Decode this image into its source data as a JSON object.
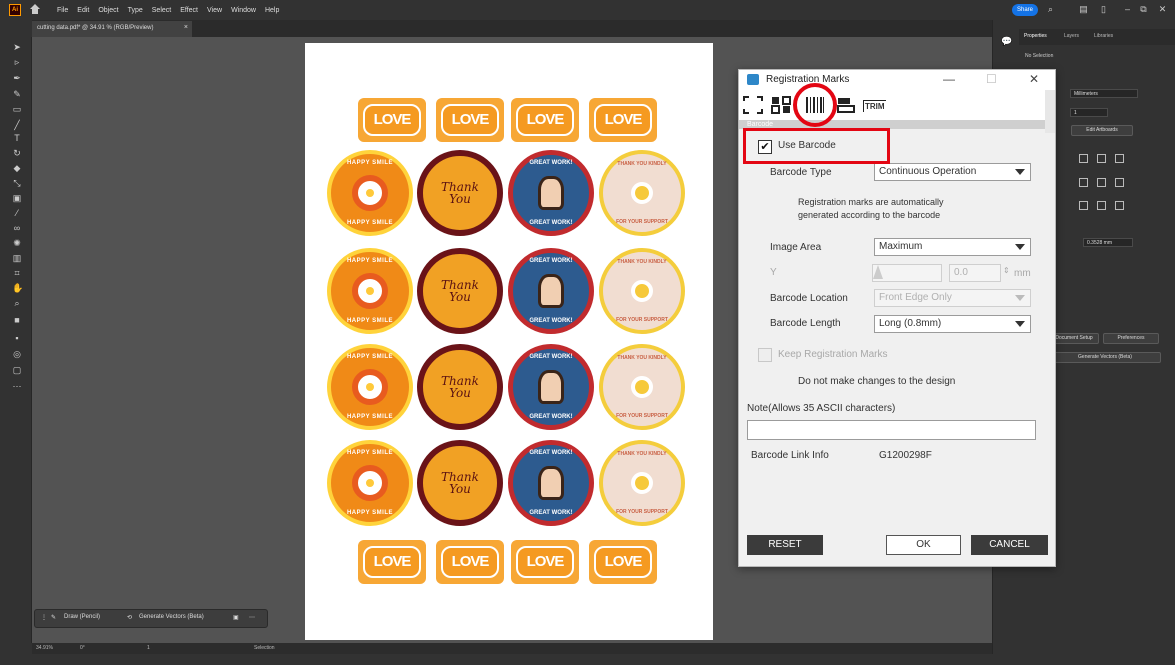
{
  "app": {
    "logo": "Ai",
    "menus": [
      "File",
      "Edit",
      "Object",
      "Type",
      "Select",
      "Effect",
      "View",
      "Window",
      "Help"
    ],
    "share_label": "Share"
  },
  "document": {
    "tab_title": "cutting data.pdf* @ 34.91 % (RGB/Preview)",
    "tab_close": "×"
  },
  "artboard": {
    "love_label": "LOVE",
    "happy_top": "HAPPY SMILE",
    "happy_bottom": "HAPPY SMILE",
    "thank_line1": "Thank",
    "thank_line2": "You",
    "great_top": "GREAT WORK!",
    "great_bottom": "GREAT WORK!",
    "kind_top": "THANK YOU KINDLY",
    "kind_bottom": "FOR YOUR SUPPORT"
  },
  "floating_bar": {
    "draw_label": "Draw (Pencil)",
    "generate_label": "Generate Vectors (Beta)",
    "more": "⋯"
  },
  "status_bar": {
    "zoom": "34.91%",
    "rotation": "0°",
    "artboard": "1",
    "mode": "Selection"
  },
  "right_panel": {
    "tabs": [
      "Properties",
      "Layers",
      "Libraries"
    ],
    "no_selection": "No Selection",
    "units_value": "Millimeters",
    "artboard_value": "1",
    "edit_artboards": "Edit Artboards",
    "increment_value": "0.3528 mm",
    "doc_setup": "Document Setup",
    "preferences": "Preferences",
    "generate_vectors": "Generate Vectors (Beta)"
  },
  "dialog": {
    "title": "Registration Marks",
    "section_header": "Barcode",
    "trim_label": "TRIM",
    "use_barcode_label": "Use Barcode",
    "use_barcode_checked": "✔",
    "barcode_type_label": "Barcode Type",
    "barcode_type_value": "Continuous Operation",
    "info_line1": "Registration marks are automatically",
    "info_line2": "generated according to the barcode",
    "image_area_label": "Image Area",
    "image_area_value": "Maximum",
    "y_label": "Y",
    "y_value": "0.0",
    "y_unit": "mm",
    "barcode_location_label": "Barcode Location",
    "barcode_location_value": "Front Edge Only",
    "barcode_length_label": "Barcode Length",
    "barcode_length_value": "Long (0.8mm)",
    "keep_marks_label": "Keep Registration Marks",
    "no_change_text": "Do not make changes to the design",
    "note_label": "Note(Allows 35 ASCII characters)",
    "note_value": "",
    "link_info_label": "Barcode Link Info",
    "link_info_value": "G1200298F",
    "reset_label": "RESET",
    "ok_label": "OK",
    "cancel_label": "CANCEL",
    "minimize": "—",
    "maximize": "☐",
    "close": "✕"
  },
  "colors": {
    "highlight": "#e30613",
    "share": "#1473e6",
    "love_orange": "#f7a735"
  }
}
